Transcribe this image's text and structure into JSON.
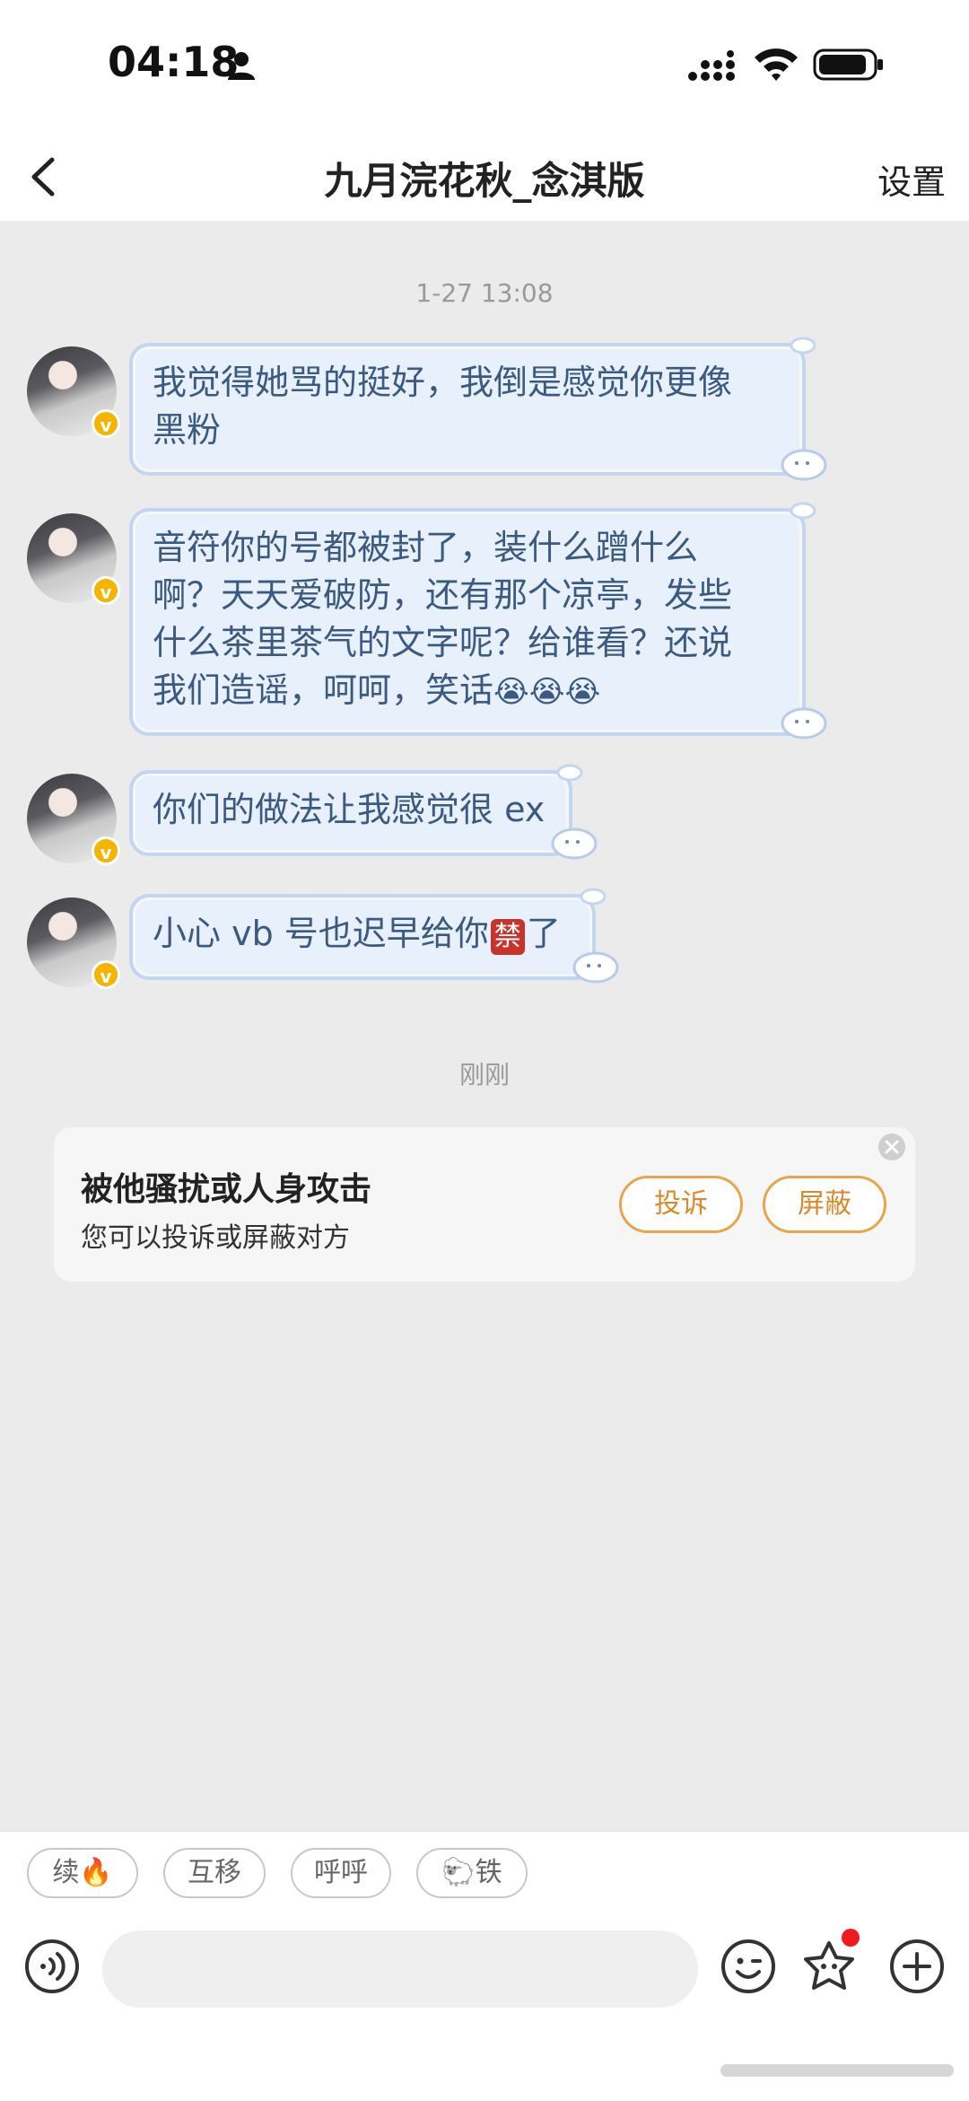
{
  "status_bar": {
    "time": "04:18"
  },
  "nav": {
    "title": "九月浣花秋_念淇版",
    "settings_label": "设置"
  },
  "chat": {
    "timestamp": "1-27 13:08",
    "messages": [
      {
        "line1": "我觉得她骂的挺好，我倒是感觉你更像",
        "line2": "黑粉"
      },
      {
        "line1": "音符你的号都被封了，装什么蹭什么",
        "line2": "啊？天天爱破防，还有那个凉亭，发些",
        "line3": "什么茶里茶气的文字呢？给谁看？还说",
        "line4": "我们造谣，呵呵，笑话",
        "emojis": "😭😭😭"
      },
      {
        "text": "你们的做法让我感觉很 ex"
      },
      {
        "before": "小心 vb 号也迟早给你",
        "badge": "禁",
        "after": "了"
      }
    ],
    "recent_label": "刚刚"
  },
  "report_card": {
    "title": "被他骚扰或人身攻击",
    "subtitle": "您可以投诉或屏蔽对方",
    "complain_label": "投诉",
    "block_label": "屏蔽"
  },
  "quick_replies": [
    {
      "text": "续",
      "emoji": "🔥"
    },
    {
      "text": "互移"
    },
    {
      "text": "呼呼"
    },
    {
      "emoji": "🐑",
      "text": "铁"
    }
  ],
  "colors": {
    "accent_orange": "#e8a54b",
    "bubble_bg": "#e8f0fb",
    "bubble_text": "#3a5a82",
    "notification_dot": "#f01b1b"
  },
  "icons": [
    "person-icon",
    "signal-icon",
    "wifi-icon",
    "battery-icon",
    "back-icon",
    "verified-icon",
    "close-icon",
    "voice-icon",
    "emoji-icon",
    "sticker-icon",
    "plus-icon"
  ]
}
